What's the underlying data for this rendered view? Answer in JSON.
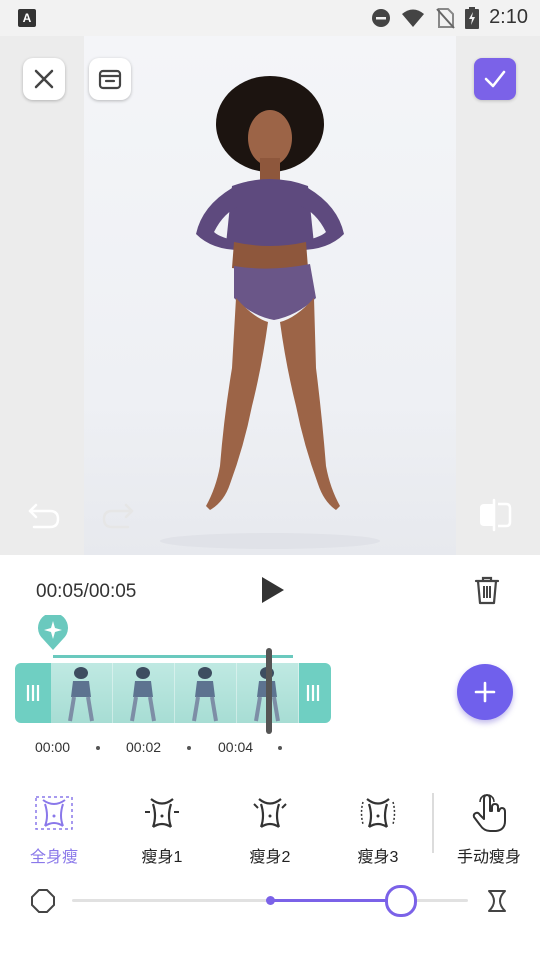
{
  "status_bar": {
    "time": "2:10",
    "icons": [
      "keyboard-a-icon",
      "dnd-icon",
      "wifi-icon",
      "no-sim-icon",
      "battery-charging-icon"
    ]
  },
  "editor": {
    "close_icon": "close-icon",
    "gallery_icon": "archive-icon",
    "confirm_icon": "check-icon",
    "undo_icon": "undo-icon",
    "redo_icon": "redo-icon",
    "compare_icon": "compare-icon",
    "accent": "#7b62e8"
  },
  "playback": {
    "time": "00:05/00:05",
    "play_icon": "play-icon",
    "delete_icon": "trash-icon"
  },
  "timeline": {
    "marker_icon": "sparkle-marker-icon",
    "ticks": [
      "00:00",
      "00:02",
      "00:04"
    ],
    "add_icon": "plus-icon",
    "accent": "#6fcfc2"
  },
  "tools": [
    {
      "label": "全身瘦",
      "icon": "full-body-slim-icon",
      "active": true
    },
    {
      "label": "瘦身1",
      "icon": "waist-slim-1-icon",
      "active": false
    },
    {
      "label": "瘦身2",
      "icon": "waist-slim-2-icon",
      "active": false
    },
    {
      "label": "瘦身3",
      "icon": "waist-slim-3-icon",
      "active": false
    },
    {
      "label": "手动瘦身",
      "icon": "manual-slim-hand-icon",
      "active": false
    }
  ],
  "slider": {
    "value_fraction": 0.83,
    "center_fraction": 0.5,
    "left_icon": "circle-shape-icon",
    "right_icon": "hourglass-shape-icon"
  }
}
